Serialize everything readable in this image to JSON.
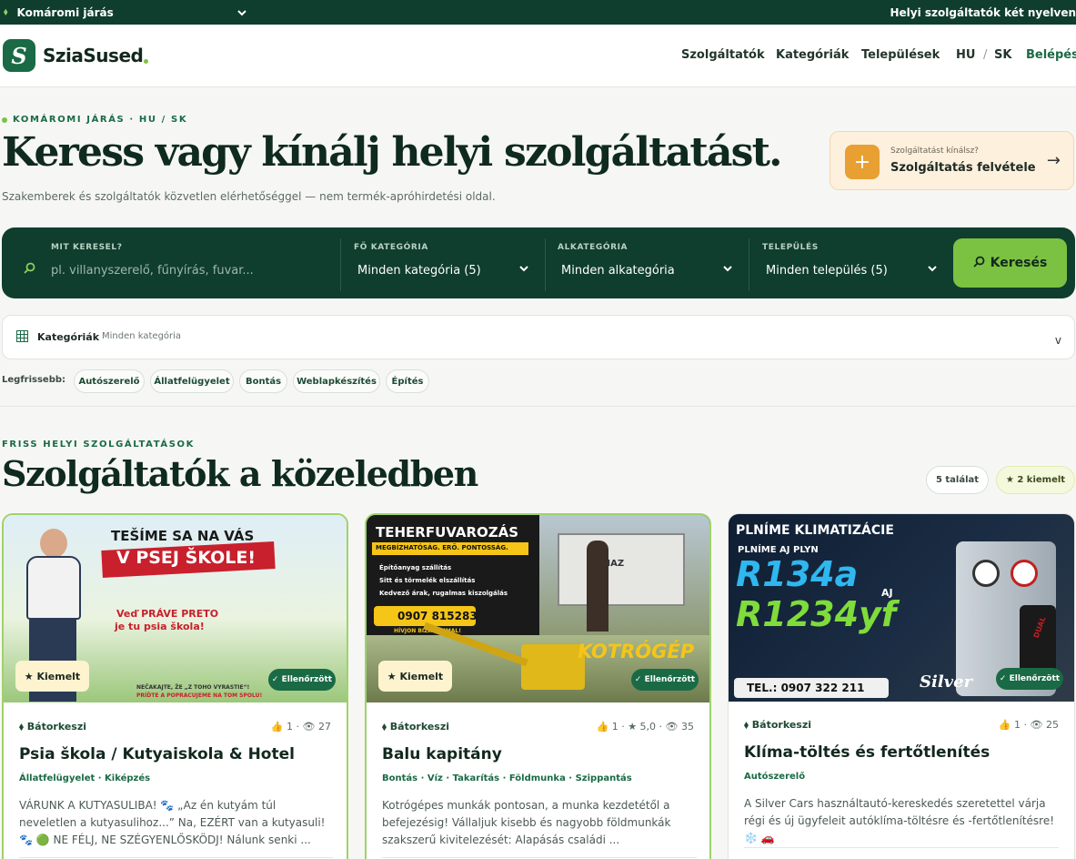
{
  "topbar": {
    "region": "Komáromi járás",
    "tagline": "Helyi szolgáltatók két nyelven"
  },
  "header": {
    "logo_letter": "S",
    "brand": "SziaSused",
    "nav": [
      "Szolgáltatók",
      "Kategóriák",
      "Települések"
    ],
    "lang_hu": "HU",
    "lang_sep": "/",
    "lang_sk": "SK",
    "login": "Belépés"
  },
  "hero": {
    "eyebrow": "KOMÁROMI JÁRÁS · HU / SK",
    "title": "Keress vagy kínálj helyi szolgáltatást.",
    "subtitle": "Szakemberek és szolgáltatók közvetlen elérhetőséggel — nem termék-apróhirdetési oldal.",
    "offer_small": "Szolgáltatást kínálsz?",
    "offer_big": "Szolgáltatás felvétele",
    "offer_plus": "+",
    "offer_arrow": "→"
  },
  "search": {
    "q_label": "MIT KERESEL?",
    "q_placeholder": "pl. villanyszerelő, fűnyírás, fuvar...",
    "cat_label": "FŐ KATEGÓRIA",
    "cat_value": "Minden kategória (5)",
    "sub_label": "ALKATEGÓRIA",
    "sub_value": "Minden alkategória",
    "town_label": "TELEPÜLÉS",
    "town_value": "Minden település (5)",
    "button": "Keresés"
  },
  "categories_bar": {
    "title": "Kategóriák",
    "value": "Minden kategória",
    "toggle": "v"
  },
  "latest": {
    "label": "Legfrissebb:",
    "chips": [
      "Autószerelő",
      "Állatfelügyelet",
      "Bontás",
      "Weblapkészítés",
      "Építés"
    ]
  },
  "section": {
    "eyebrow": "FRISS HELYI SZOLGÁLTATÁSOK",
    "title": "Szolgáltatók a közeledben",
    "count_pill": "5 találat",
    "featured_pill": "★ 2 kiemelt"
  },
  "cards": [
    {
      "location": "Bátorkeszi",
      "stats": "👍 1 · 👁 27",
      "title": "Psia škola / Kutyaiskola & Hotel",
      "tags": "Állatfelügyelet · Kiképzés",
      "desc": "VÁRUNK A KUTYASULIBA! 🐾 „Az én kutyám túl neveletlen a kutyasulihoz...” Na, EZÉRT van a kutyasuli! 🐾 🟢 NE FÉLJ, NE SZÉGYENLŐSKÖDJ! Nálunk senki ...",
      "featured_badge": "★ Kiemelt",
      "verified_badge": "✓ Ellenőrzött",
      "img_text": {
        "l1": "TEŠÍME SA NA VÁS",
        "l2": "V PSEJ ŠKOLE!",
        "l3": "Veď PRÁVE PRETO",
        "l4": "je tu psia škola!",
        "l5": "NEČAKAJTE, ŽE „Z TOHO VYRASTIE“!",
        "l6": "PRÍĎTE A POPRACUJEME NA TOM SPOLU!"
      }
    },
    {
      "location": "Bátorkeszi",
      "stats": "👍 1 · ★ 5,0 · 👁 35",
      "title": "Balu kapitány",
      "tags": "Bontás · Víz · Takarítás · Földmunka · Szippantás",
      "desc": "Kotrógépes munkák pontosan, a munka kezdetétől a befejezésig! Vállaljuk kisebb és nagyobb földmunkák szakszerű kivitelezését: Alapásás családi ...",
      "featured_badge": "★ Kiemelt",
      "verified_badge": "✓ Ellenőrzött",
      "img_text": {
        "l1": "TEHERFUVAROZÁS",
        "l2": "MEGBÍZHATÓSÁG. ERŐ. PONTOSSÁG.",
        "l3": "Építőanyag szállítás",
        "l4": "Sitt és törmelék elszállítás",
        "l5": "Kedvező árak, rugalmas kiszolgálás",
        "l6": "0907 815283",
        "l7": "HÍVJON BIZALOMMAL!",
        "l8": "KOTRÓGÉP",
        "l9": "LIAZ"
      }
    },
    {
      "location": "Bátorkeszi",
      "stats": "👍 1 · 👁 25",
      "title": "Klíma-töltés és fertőtlenítés",
      "tags": "Autószerelő",
      "desc": "A Silver Cars használtautó-kereskedés szeretettel várja régi és új ügyfeleit autóklíma-töltésre és -fertőtlenítésre! ❄️ 🚗",
      "verified_badge": "✓ Ellenőrzött",
      "img_text": {
        "l1": "PLNÍME KLIMATIZÁCIE",
        "l2": "PLNÍME AJ PLYN",
        "l3": "R134a",
        "l4": "AJ",
        "l5": "R1234yf",
        "l6": "TEL.: 0907 322 211",
        "l7": "DUAL",
        "l8": "Silver"
      }
    }
  ],
  "colors": {
    "primary": "#0f3d2e",
    "accent": "#7cc242",
    "brand": "#1a6a45",
    "offer": "#e8a032"
  }
}
